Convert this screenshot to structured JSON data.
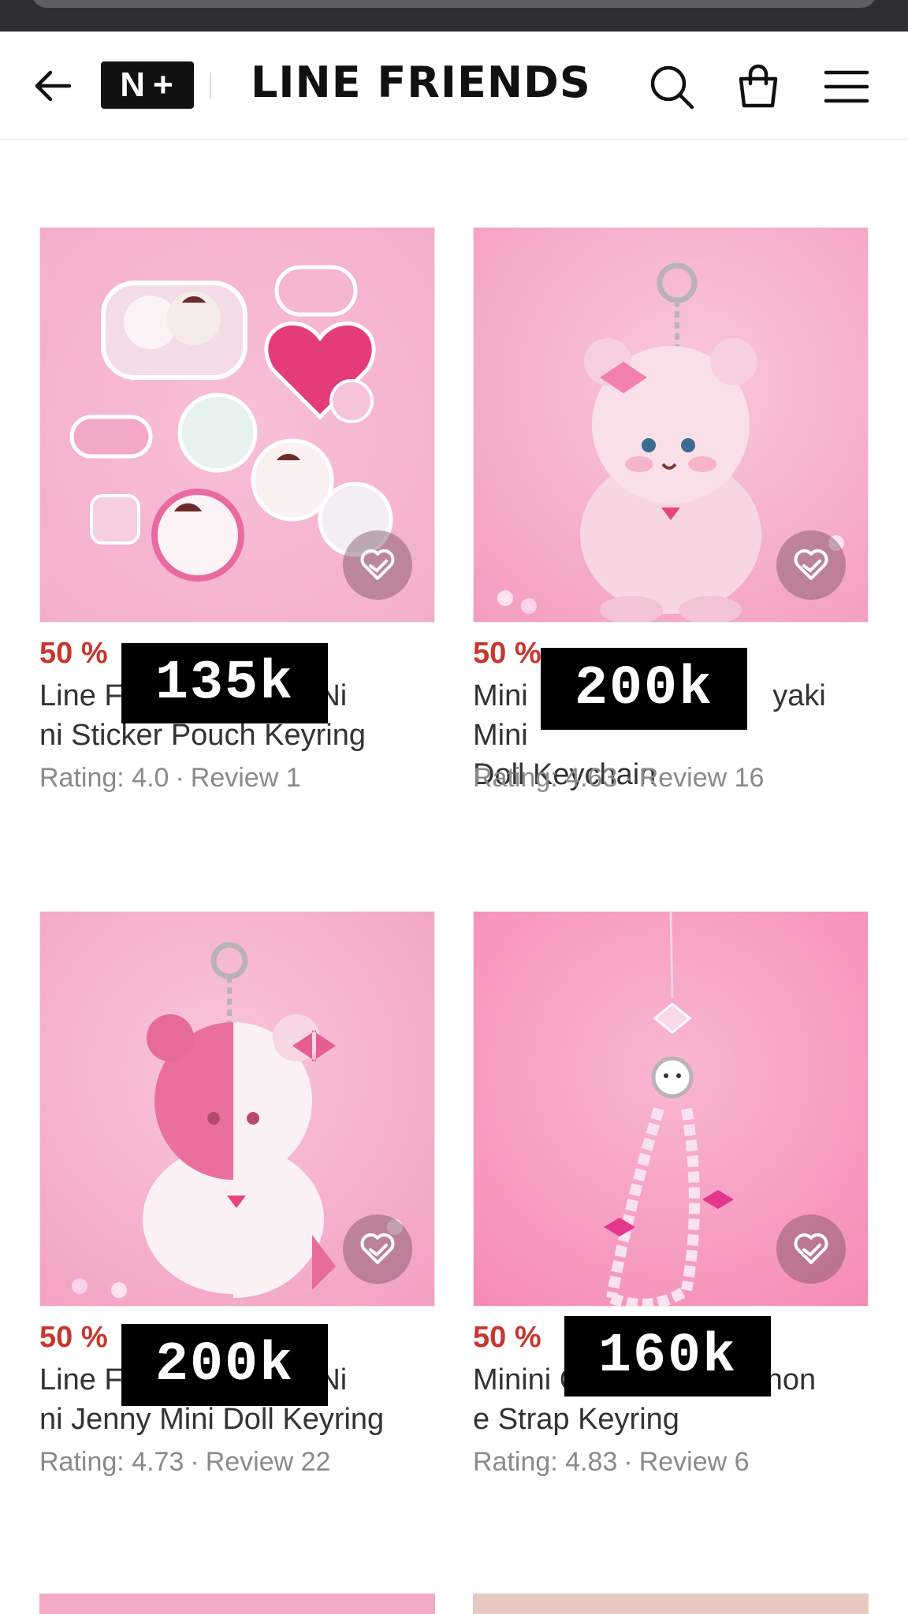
{
  "header": {
    "back_icon": "arrow-left-icon",
    "nplus_label": "N+",
    "brand": "LINE FRIENDS",
    "search_icon": "search-icon",
    "cart_icon": "shopping-bag-icon",
    "menu_icon": "hamburger-menu-icon"
  },
  "products": [
    {
      "discount": "50 %",
      "name": "Line Friends minini Cat Nini Sticker Pouch Keyring",
      "name_visible": "Line F            i Cat Ni\nni Sticker Pouch Keyring",
      "rating": "Rating: 4.0",
      "reviews": "Review 1",
      "overlay": "135k",
      "wish_icon": "heart-icon"
    },
    {
      "discount": "50 %",
      "name": "Mini Nyaki Mini Doll Keychain",
      "rating": "Rating: 4.63",
      "reviews": "Review 16",
      "overlay": "200k",
      "wish_icon": "heart-icon"
    },
    {
      "discount": "50 %",
      "name": "Line Friends minini Cat Nini Jenny Mini Doll Keyring",
      "rating": "Rating: 4.73",
      "reviews": "Review 22",
      "overlay": "200k",
      "wish_icon": "heart-icon"
    },
    {
      "discount": "50 %",
      "name": "Minini Cathini Nyagi Phone Strap Keyring",
      "rating": "Rating: 4.83",
      "reviews": "Review 6",
      "overlay": "160k",
      "wish_icon": "heart-icon"
    }
  ],
  "colors": {
    "discount": "#c8372d",
    "pink_bg": "#f6b4cf",
    "overlay_bg": "#000000"
  }
}
